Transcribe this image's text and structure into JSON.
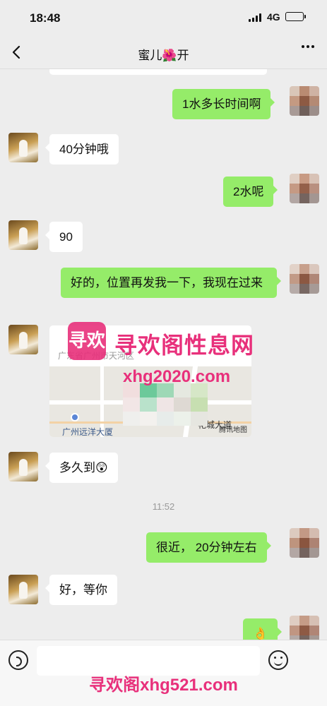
{
  "status_bar": {
    "time": "18:48",
    "network": "4G"
  },
  "header": {
    "title": "蜜儿🌺开"
  },
  "messages": [
    {
      "side": "out",
      "text": "1水多长时间啊"
    },
    {
      "side": "in",
      "text": "40分钟哦"
    },
    {
      "side": "out",
      "text": "2水呢"
    },
    {
      "side": "in",
      "text": "90"
    },
    {
      "side": "out",
      "text": "好的，位置再发我一下，我现在过来"
    },
    {
      "side": "in",
      "type": "location",
      "address": "广东省广州市天河区",
      "map_labels": [
        "广州远洋大厦",
        "花城大道"
      ],
      "map_credit": "腾讯地图"
    },
    {
      "side": "in",
      "text": "多久到😲"
    },
    {
      "side": "out",
      "text": "很近， 20分钟左右"
    },
    {
      "side": "in",
      "text": "好，等你"
    },
    {
      "side": "out",
      "text": "👌"
    }
  ],
  "timestamp": "11:52",
  "watermark": {
    "logo": "寻欢",
    "title": "寻欢阁性息网",
    "site": "xhg2020.com",
    "footer": "寻欢阁xhg521.com"
  }
}
